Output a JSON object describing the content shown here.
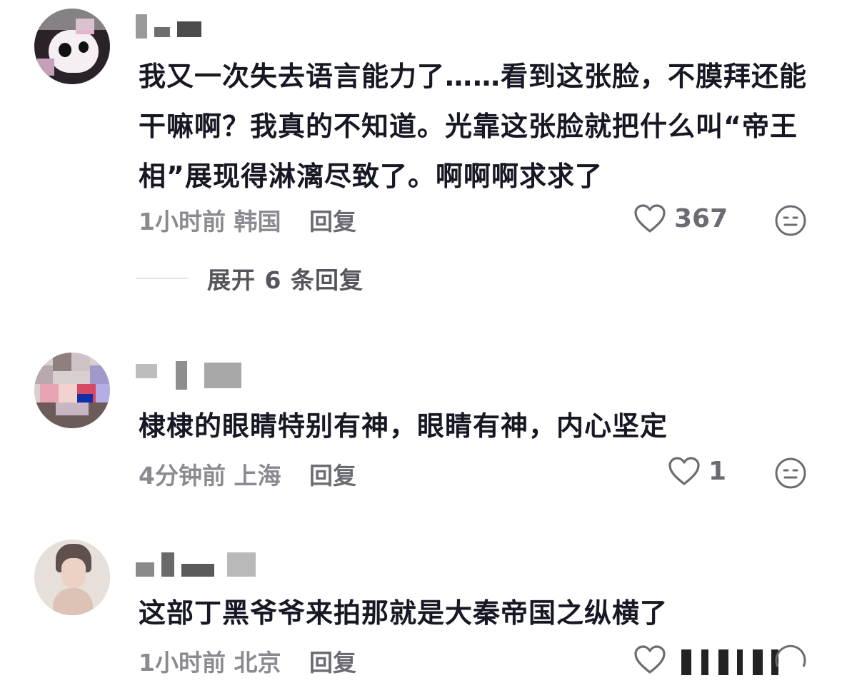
{
  "comments": [
    {
      "text": "我又一次失去语言能力了……看到这张脸，不膜拜还能干嘛啊？我真的不知道。光靠这张脸就把什么叫“帝王相”展现得淋漓尽致了。啊啊啊求求了",
      "time": "1小时前",
      "location": "韩国",
      "reply_label": "回复",
      "likes": "367",
      "expand_label": "展开 6 条回复"
    },
    {
      "text": "棣棣的眼睛特别有神，眼睛有神，内心坚定",
      "time": "4分钟前",
      "location": "上海",
      "reply_label": "回复",
      "likes": "1"
    },
    {
      "text": "这部丁黑爷爷来拍那就是大秦帝国之纵横了",
      "time": "1小时前",
      "location": "北京",
      "reply_label": "回复",
      "likes": ""
    }
  ],
  "icons": {
    "like": "heart-outline-icon",
    "emoji": "neutral-face-icon"
  },
  "colors": {
    "text": "#161823",
    "meta": "#8a8b91",
    "icon": "#6b6c72"
  }
}
